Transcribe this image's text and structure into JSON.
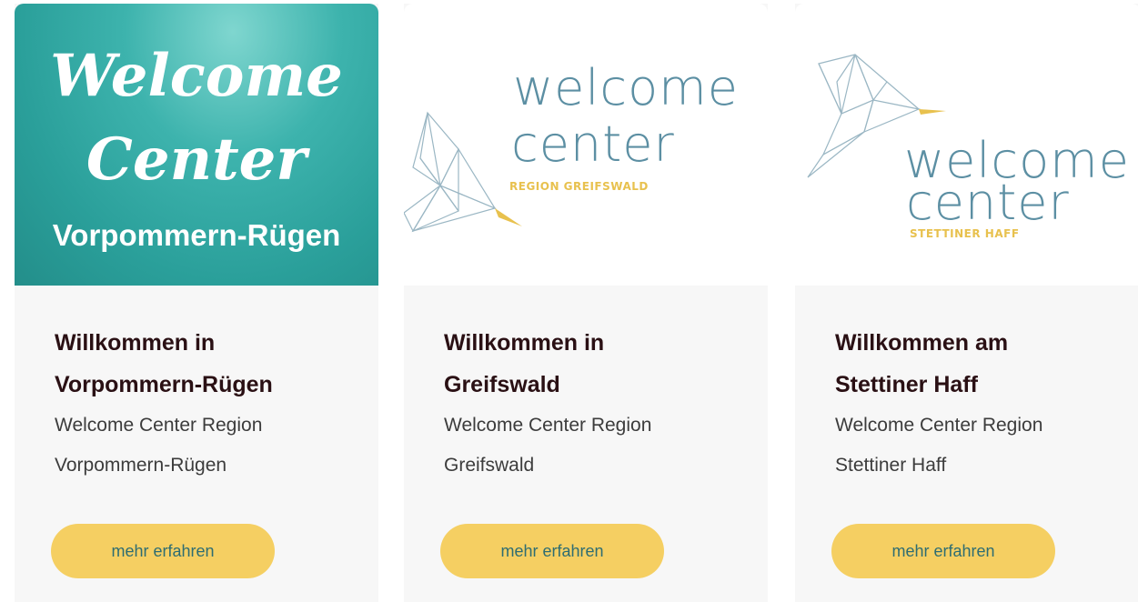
{
  "cards": [
    {
      "logo": {
        "line1": "Welcome",
        "line2": "Center",
        "region": "Vorpommern-Rügen"
      },
      "title_line1": "Willkommen in",
      "title_line2": "Vorpommern-Rügen",
      "subtitle_line1": "Welcome Center Region",
      "subtitle_line2": "Vorpommern-Rügen",
      "button": "mehr erfahren"
    },
    {
      "logo": {
        "line1": "welcome",
        "line2": "center",
        "region": "REGION GREIFSWALD"
      },
      "title_line1": "Willkommen in",
      "title_line2": "Greifswald",
      "subtitle_line1": "Welcome Center Region",
      "subtitle_line2": "Greifswald",
      "button": "mehr erfahren"
    },
    {
      "logo": {
        "line1": "welcome",
        "line2": "center",
        "region": "STETTINER HAFF"
      },
      "title_line1": "Willkommen am",
      "title_line2": "Stettiner Haff",
      "subtitle_line1": "Welcome Center Region",
      "subtitle_line2": "Stettiner Haff",
      "button": "mehr erfahren"
    }
  ],
  "colors": {
    "accent_button": "#f5cf62",
    "button_text": "#2e6d72",
    "title_text": "#2a1014",
    "teal_logo": "#2a9f9a",
    "logo_blue": "#5c8fa3",
    "logo_gold": "#e8c14e"
  },
  "icons": [
    "origami-bird-icon"
  ]
}
